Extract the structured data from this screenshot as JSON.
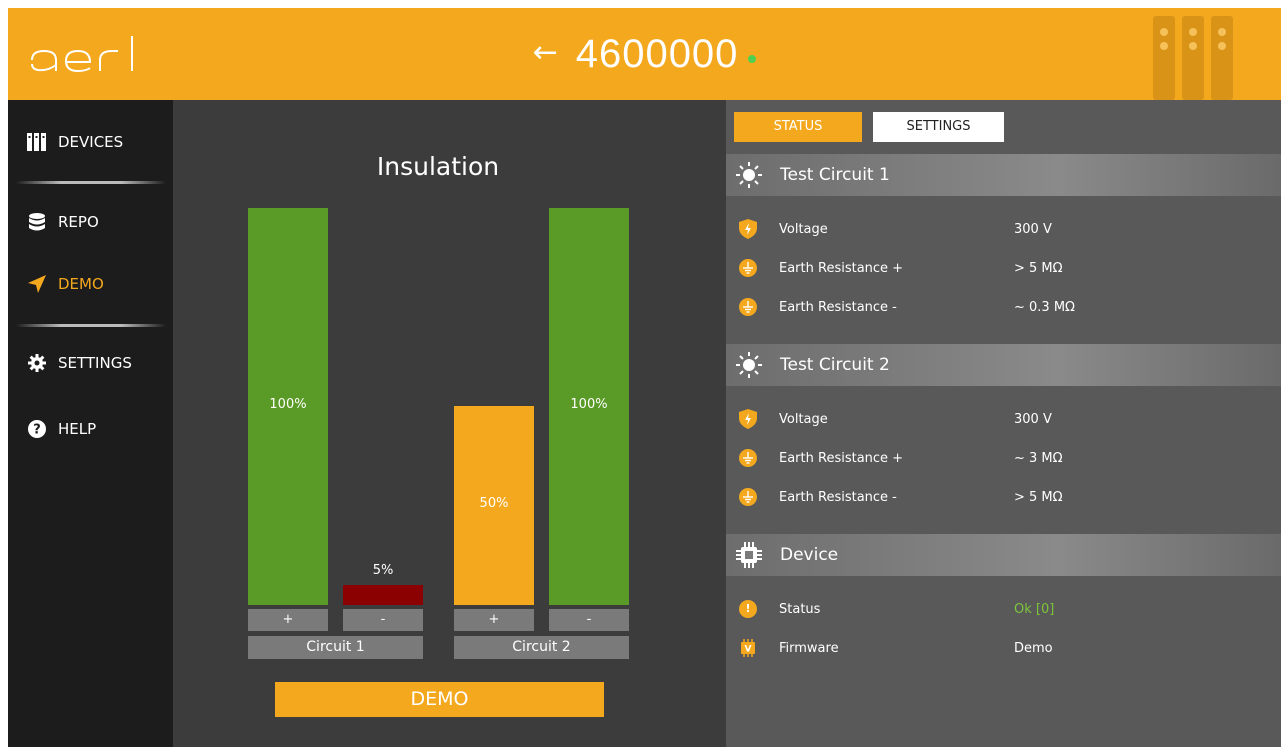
{
  "header": {
    "logo_text": "aerl",
    "title": "4600000",
    "back_glyph": "←",
    "status_dot_color": "#4fcf4f",
    "accent": "#f4a81e"
  },
  "sidebar": {
    "items": [
      {
        "label": "DEVICES",
        "icon": "devices-icon"
      },
      {
        "label": "REPO",
        "icon": "database-icon"
      },
      {
        "label": "DEMO",
        "icon": "send-icon",
        "active": true
      },
      {
        "label": "SETTINGS",
        "icon": "gear-icon"
      },
      {
        "label": "HELP",
        "icon": "help-icon"
      }
    ]
  },
  "chart": {
    "title": "Insulation",
    "demo_button": "DEMO",
    "circuits": [
      {
        "name": "Circuit 1",
        "bars": [
          {
            "sign": "+",
            "value": 100,
            "label": "100%",
            "color": "#5a9a26"
          },
          {
            "sign": "-",
            "value": 5,
            "label": "5%",
            "color": "#8b0000"
          }
        ]
      },
      {
        "name": "Circuit 2",
        "bars": [
          {
            "sign": "+",
            "value": 50,
            "label": "50%",
            "color": "#f4a81e"
          },
          {
            "sign": "-",
            "value": 100,
            "label": "100%",
            "color": "#5a9a26"
          }
        ]
      }
    ]
  },
  "panel": {
    "tabs": {
      "status": "STATUS",
      "settings": "SETTINGS"
    },
    "sections": [
      {
        "title": "Test Circuit 1",
        "icon": "sun-icon",
        "rows": [
          {
            "icon": "shield-bolt-icon",
            "label": "Voltage",
            "value": "300 V"
          },
          {
            "icon": "ground-icon",
            "label": "Earth Resistance +",
            "value": "> 5 MΩ"
          },
          {
            "icon": "ground-icon",
            "label": "Earth Resistance -",
            "value": "~ 0.3 MΩ"
          }
        ]
      },
      {
        "title": "Test Circuit 2",
        "icon": "sun-icon",
        "rows": [
          {
            "icon": "shield-bolt-icon",
            "label": "Voltage",
            "value": "300 V"
          },
          {
            "icon": "ground-icon",
            "label": "Earth Resistance +",
            "value": "~ 3 MΩ"
          },
          {
            "icon": "ground-icon",
            "label": "Earth Resistance -",
            "value": "> 5 MΩ"
          }
        ]
      },
      {
        "title": "Device",
        "icon": "chip-icon",
        "rows": [
          {
            "icon": "alert-icon",
            "label": "Status",
            "value": "Ok [0]",
            "value_color": "#7dc43a"
          },
          {
            "icon": "firmware-icon",
            "label": "Firmware",
            "value": "Demo"
          }
        ]
      }
    ]
  },
  "chart_data": {
    "type": "bar",
    "title": "Insulation",
    "categories": [
      "Circuit 1 +",
      "Circuit 1 -",
      "Circuit 2 +",
      "Circuit 2 -"
    ],
    "values": [
      100,
      5,
      50,
      100
    ],
    "ylim": [
      0,
      100
    ]
  }
}
